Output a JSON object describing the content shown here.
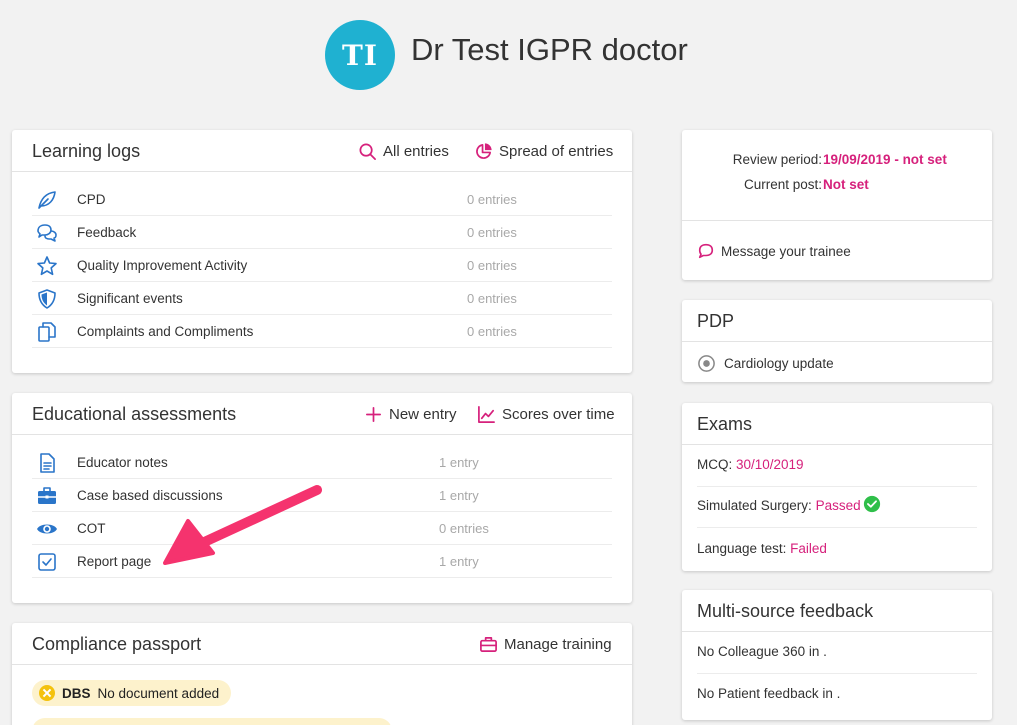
{
  "header": {
    "avatar_initials": "TI",
    "doctor_name": "Dr Test IGPR doctor"
  },
  "learning_logs": {
    "title": "Learning logs",
    "actions": [
      {
        "label": "All entries",
        "icon": "search-icon"
      },
      {
        "label": "Spread of entries",
        "icon": "pie-chart-icon"
      }
    ],
    "items": [
      {
        "label": "CPD",
        "count": "0 entries",
        "icon": "leaf-icon"
      },
      {
        "label": "Feedback",
        "count": "0 entries",
        "icon": "chat-bubbles-icon"
      },
      {
        "label": "Quality Improvement Activity",
        "count": "0 entries",
        "icon": "star-icon"
      },
      {
        "label": "Significant events",
        "count": "0 entries",
        "icon": "shield-icon"
      },
      {
        "label": "Complaints and Compliments",
        "count": "0 entries",
        "icon": "copy-documents-icon"
      }
    ]
  },
  "educational_assessments": {
    "title": "Educational assessments",
    "actions": [
      {
        "label": "New entry",
        "icon": "plus-icon"
      },
      {
        "label": "Scores over time",
        "icon": "line-chart-icon"
      }
    ],
    "items": [
      {
        "label": "Educator notes",
        "count": "1 entry",
        "icon": "document-icon"
      },
      {
        "label": "Case based discussions",
        "count": "1 entry",
        "icon": "briefcase-icon"
      },
      {
        "label": "COT",
        "count": "0 entries",
        "icon": "eye-icon"
      },
      {
        "label": "Report page",
        "count": "1 entry",
        "icon": "checkbox-icon"
      }
    ]
  },
  "compliance_passport": {
    "title": "Compliance passport",
    "action": {
      "label": "Manage training",
      "icon": "briefcase-icon"
    },
    "badges": [
      {
        "name": "DBS",
        "status": "No document added"
      }
    ]
  },
  "review": {
    "review_period_label": "Review period:",
    "review_period_value": "19/09/2019 - not set",
    "current_post_label": "Current post:",
    "current_post_value": "Not set",
    "message_link": "Message your trainee"
  },
  "pdp": {
    "title": "PDP",
    "items": [
      {
        "label": "Cardiology update"
      }
    ]
  },
  "exams": {
    "title": "Exams",
    "items": [
      {
        "label": "MCQ:",
        "value": "30/10/2019"
      },
      {
        "label": "Simulated Surgery:",
        "value": "Passed"
      },
      {
        "label": "Language test:",
        "value": "Failed"
      }
    ]
  },
  "msf": {
    "title": "Multi-source feedback",
    "items": [
      {
        "text": "No Colleague 360 in ."
      },
      {
        "text": "No Patient feedback in ."
      }
    ]
  },
  "colors": {
    "accent": "#d6217c",
    "icon_blue": "#2a75c9",
    "avatar": "#1fb1d1",
    "success": "#2fbf4a",
    "annotation": "#f5336e"
  }
}
